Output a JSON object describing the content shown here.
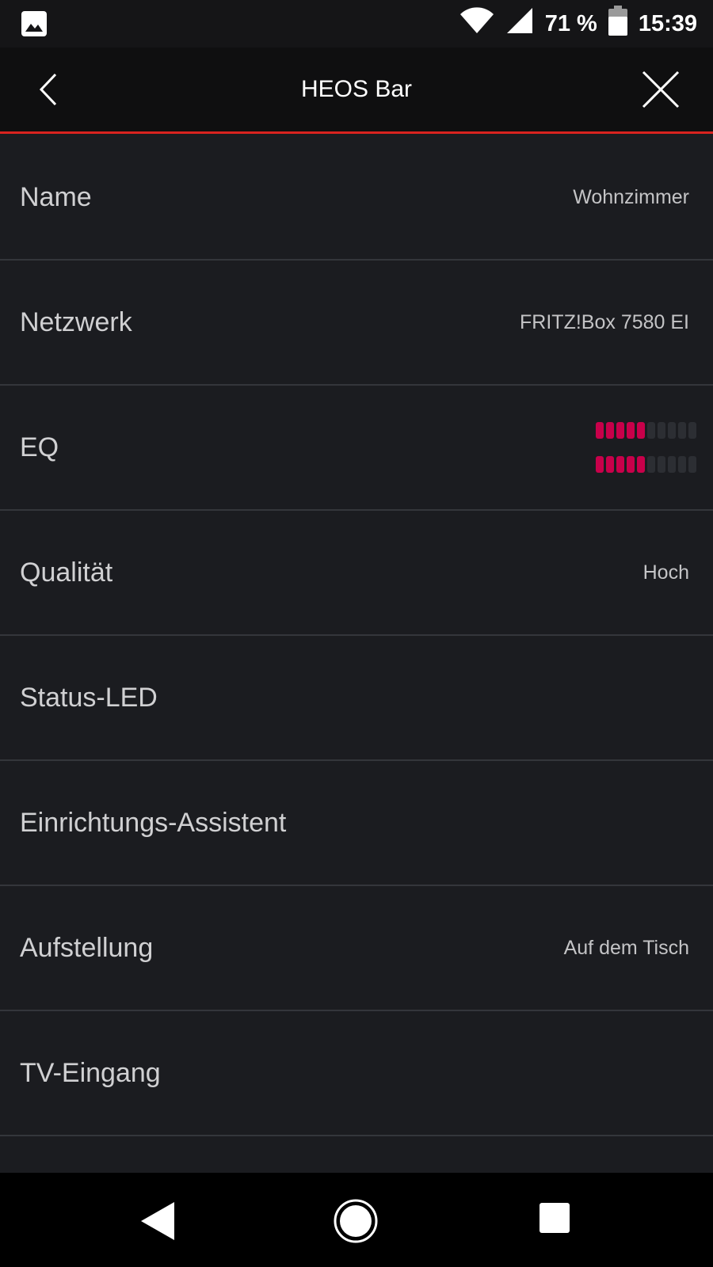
{
  "status_bar": {
    "battery_percent": "71 %",
    "time": "15:39",
    "icons": [
      "gallery-icon",
      "wifi-icon",
      "signal-icon",
      "battery-icon"
    ]
  },
  "header": {
    "title": "HEOS Bar",
    "back_icon": "chevron-left-icon",
    "close_icon": "close-icon"
  },
  "settings": [
    {
      "label": "Name",
      "value": "Wohnzimmer"
    },
    {
      "label": "Netzwerk",
      "value": "FRITZ!Box 7580 EI"
    },
    {
      "label": "EQ",
      "value": ""
    },
    {
      "label": "Qualität",
      "value": "Hoch"
    },
    {
      "label": "Status-LED",
      "value": ""
    },
    {
      "label": "Einrichtungs-Assistent",
      "value": ""
    },
    {
      "label": "Aufstellung",
      "value": "Auf dem Tisch"
    },
    {
      "label": "TV-Eingang",
      "value": ""
    }
  ],
  "eq": {
    "segments_total": 10,
    "treble_level": 5,
    "bass_level": 5,
    "active_color": "#c8004a",
    "inactive_color": "#2c2e33"
  },
  "colors": {
    "accent": "#d9231f",
    "background": "#1b1c20",
    "header_background": "#0f0f10"
  },
  "nav_bar": {
    "icons": [
      "nav-back-icon",
      "nav-home-icon",
      "nav-recents-icon"
    ]
  }
}
